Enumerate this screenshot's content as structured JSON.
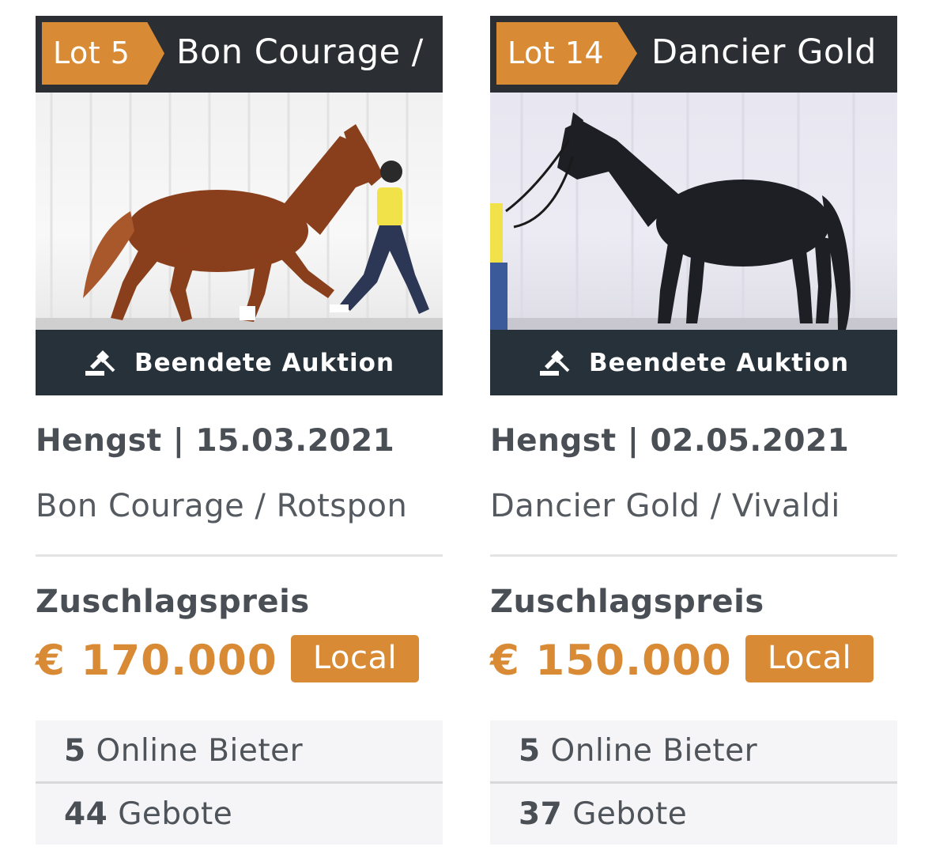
{
  "cards": [
    {
      "lot_label": "Lot 5",
      "title": "Bon Courage /",
      "status": "Beendete Auktion",
      "gender": "Hengst",
      "date": "15.03.2021",
      "pedigree": "Bon Courage / Rotspon",
      "price_label": "Zuschlagspreis",
      "price": "€ 170.000",
      "badge": "Local",
      "bidders_count": "5",
      "bidders_label": "Online Bieter",
      "bids_count": "44",
      "bids_label": "Gebote"
    },
    {
      "lot_label": "Lot 14",
      "title": "Dancier Gold",
      "status": "Beendete Auktion",
      "gender": "Hengst",
      "date": "02.05.2021",
      "pedigree": "Dancier Gold / Vivaldi",
      "price_label": "Zuschlagspreis",
      "price": "€ 150.000",
      "badge": "Local",
      "bidders_count": "5",
      "bidders_label": "Online Bieter",
      "bids_count": "37",
      "bids_label": "Gebote"
    }
  ],
  "colors": {
    "accent": "#d98a35",
    "header_bg": "#2b2f33",
    "status_bg": "#27313a",
    "text": "#4a4f56"
  },
  "icons": {
    "status_icon": "gavel-icon"
  }
}
